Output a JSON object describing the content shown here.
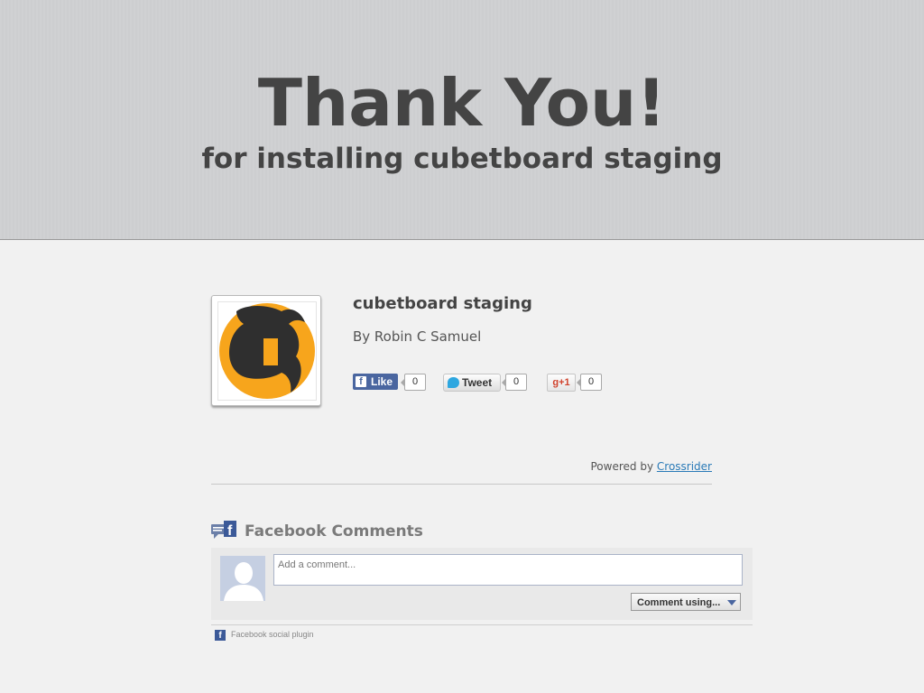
{
  "hero": {
    "title": "Thank You!",
    "subtitle": "for installing cubetboard staging"
  },
  "app": {
    "name": "cubetboard staging",
    "author": "By Robin C Samuel",
    "logo_colors": {
      "circle": "#f7a51c",
      "mark": "#2f2f2f"
    }
  },
  "social": {
    "like": {
      "label": "Like",
      "count": "0"
    },
    "tweet": {
      "label": "Tweet",
      "count": "0"
    },
    "gplus": {
      "label": "+1",
      "count": "0"
    }
  },
  "powered": {
    "prefix": "Powered by",
    "link": "Crossrider"
  },
  "facebook_comments": {
    "title": "Facebook Comments",
    "placeholder": "Add a comment...",
    "comment_using": "Comment using...",
    "plugin_text": "Facebook social plugin"
  },
  "colors": {
    "facebook_blue": "#3b5998",
    "link_blue": "#2a7ab7",
    "hero_bg": "#cfd0d2"
  }
}
